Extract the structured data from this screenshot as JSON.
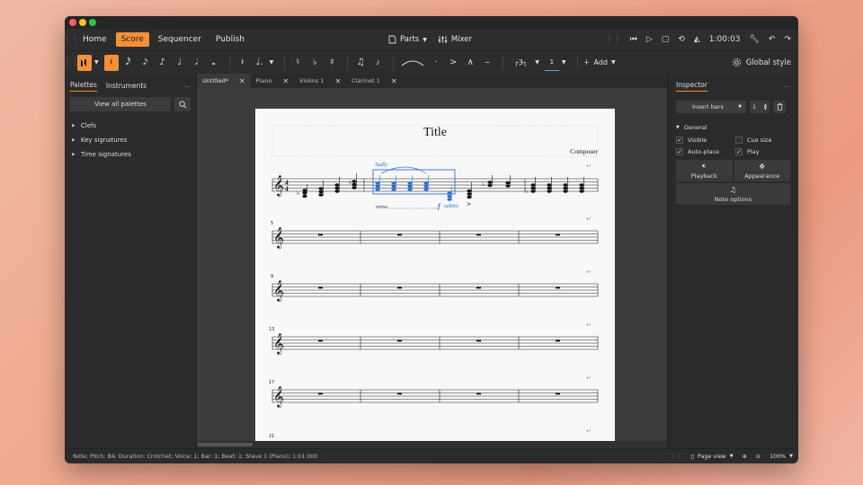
{
  "menubar": {
    "nav": [
      "Home",
      "Score",
      "Sequencer",
      "Publish"
    ],
    "active": "Score",
    "parts_label": "Parts",
    "mixer_label": "Mixer",
    "time": "1:00:03"
  },
  "toolbar": {
    "global_style_label": "Global style",
    "tuplet_value": "3",
    "voice_value": "1",
    "add_label": "Add"
  },
  "left_panel": {
    "tabs": [
      "Palettes",
      "Instruments"
    ],
    "view_all_label": "View all palettes",
    "palettes": [
      "Clefs",
      "Key signatures",
      "Time signatures"
    ]
  },
  "doc_tabs": [
    "Untitled*",
    "Piano",
    "Violins 1",
    "Clarinet 1"
  ],
  "score": {
    "title": "Title",
    "composer": "Composer",
    "expression": "Sadly",
    "crescendo": "cresc.",
    "dynamic": "f",
    "dynamic_text": "subito",
    "measure_numbers": [
      "5",
      "9",
      "13",
      "17",
      "21"
    ],
    "time_sig": [
      "4",
      "4"
    ]
  },
  "inspector": {
    "title": "Inspector",
    "insert_label": "Insert bars",
    "insert_count": "1",
    "section": "General",
    "checks": [
      {
        "label": "Visible",
        "checked": true
      },
      {
        "label": "Cue size",
        "checked": false
      },
      {
        "label": "Auto-place",
        "checked": true
      },
      {
        "label": "Play",
        "checked": true
      }
    ],
    "buttons": [
      "Playback",
      "Appearance",
      "Note options"
    ]
  },
  "status": {
    "text": "Note; Pitch: B4; Duration: Crotchet; Voice: 1; Bar: 1; Beat: 1; Stave 1 (Piano); 1:01:000",
    "view_mode": "Page view",
    "zoom": "100%"
  },
  "colors": {
    "accent": "#f48f3a",
    "selection": "#2f6fd6"
  }
}
